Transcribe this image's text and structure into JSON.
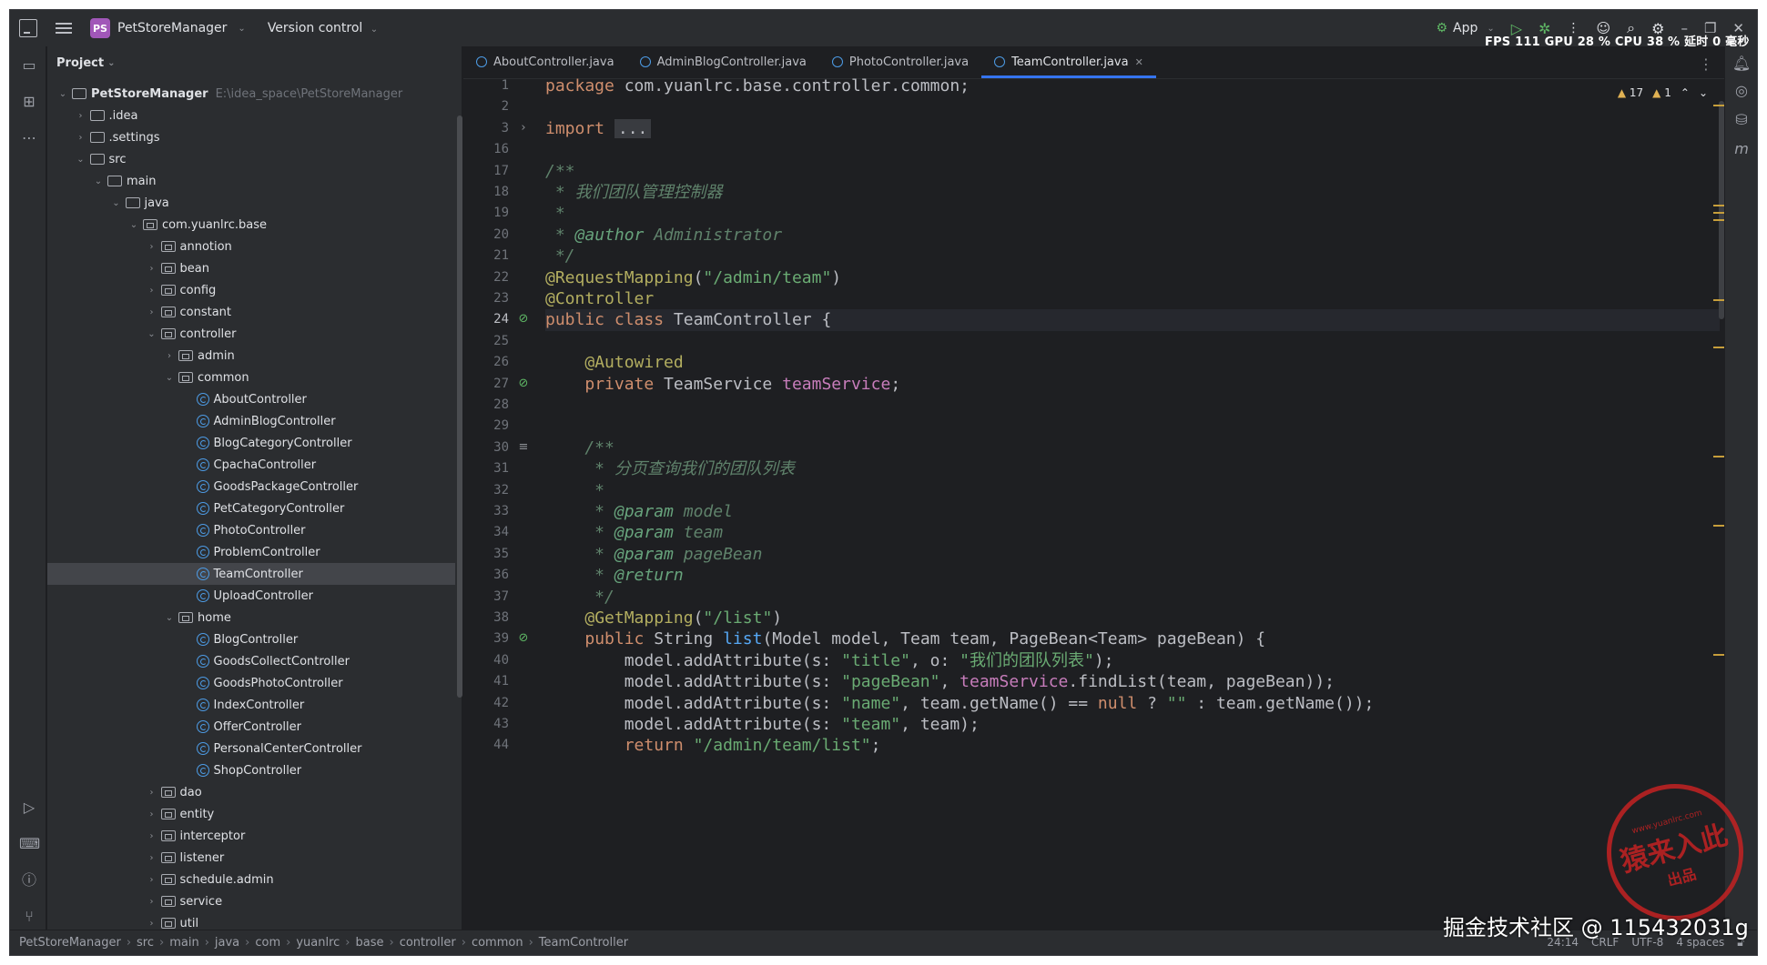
{
  "titlebar": {
    "project_badge": "PS",
    "project_name": "PetStoreManager",
    "version_control": "Version control",
    "run_config": "App",
    "fps": "FPS",
    "fps_value": "111",
    "gpu": "GPU",
    "gpu_value": "28 %",
    "cpu": "CPU",
    "cpu_value": "38 %",
    "latency": "延时",
    "latency_value": "0 毫秒"
  },
  "project_panel": {
    "title": "Project",
    "root": "PetStoreManager",
    "root_path": "E:\\idea_space\\PetStoreManager",
    "items": [
      {
        "label": "PetStoreManager",
        "depth": 0,
        "kind": "root",
        "open": true
      },
      {
        "label": ".idea",
        "depth": 1,
        "kind": "folder",
        "open": false
      },
      {
        "label": ".settings",
        "depth": 1,
        "kind": "folder",
        "open": false
      },
      {
        "label": "src",
        "depth": 1,
        "kind": "folder",
        "open": true
      },
      {
        "label": "main",
        "depth": 2,
        "kind": "folder",
        "open": true
      },
      {
        "label": "java",
        "depth": 3,
        "kind": "folder",
        "open": true
      },
      {
        "label": "com.yuanlrc.base",
        "depth": 4,
        "kind": "pkg",
        "open": true
      },
      {
        "label": "annotion",
        "depth": 5,
        "kind": "pkg",
        "open": false
      },
      {
        "label": "bean",
        "depth": 5,
        "kind": "pkg",
        "open": false
      },
      {
        "label": "config",
        "depth": 5,
        "kind": "pkg",
        "open": false
      },
      {
        "label": "constant",
        "depth": 5,
        "kind": "pkg",
        "open": false
      },
      {
        "label": "controller",
        "depth": 5,
        "kind": "pkg",
        "open": true
      },
      {
        "label": "admin",
        "depth": 6,
        "kind": "pkg",
        "open": false
      },
      {
        "label": "common",
        "depth": 6,
        "kind": "pkg",
        "open": true
      },
      {
        "label": "AboutController",
        "depth": 7,
        "kind": "class"
      },
      {
        "label": "AdminBlogController",
        "depth": 7,
        "kind": "class"
      },
      {
        "label": "BlogCategoryController",
        "depth": 7,
        "kind": "class"
      },
      {
        "label": "CpachaController",
        "depth": 7,
        "kind": "class"
      },
      {
        "label": "GoodsPackageController",
        "depth": 7,
        "kind": "class"
      },
      {
        "label": "PetCategoryController",
        "depth": 7,
        "kind": "class"
      },
      {
        "label": "PhotoController",
        "depth": 7,
        "kind": "class"
      },
      {
        "label": "ProblemController",
        "depth": 7,
        "kind": "class"
      },
      {
        "label": "TeamController",
        "depth": 7,
        "kind": "class",
        "selected": true
      },
      {
        "label": "UploadController",
        "depth": 7,
        "kind": "class"
      },
      {
        "label": "home",
        "depth": 6,
        "kind": "pkg",
        "open": true
      },
      {
        "label": "BlogController",
        "depth": 7,
        "kind": "class"
      },
      {
        "label": "GoodsCollectController",
        "depth": 7,
        "kind": "class"
      },
      {
        "label": "GoodsPhotoController",
        "depth": 7,
        "kind": "class"
      },
      {
        "label": "IndexController",
        "depth": 7,
        "kind": "class"
      },
      {
        "label": "OfferController",
        "depth": 7,
        "kind": "class"
      },
      {
        "label": "PersonalCenterController",
        "depth": 7,
        "kind": "class"
      },
      {
        "label": "ShopController",
        "depth": 7,
        "kind": "class"
      },
      {
        "label": "dao",
        "depth": 5,
        "kind": "pkg",
        "open": false
      },
      {
        "label": "entity",
        "depth": 5,
        "kind": "pkg",
        "open": false
      },
      {
        "label": "interceptor",
        "depth": 5,
        "kind": "pkg",
        "open": false
      },
      {
        "label": "listener",
        "depth": 5,
        "kind": "pkg",
        "open": false
      },
      {
        "label": "schedule.admin",
        "depth": 5,
        "kind": "pkg",
        "open": false
      },
      {
        "label": "service",
        "depth": 5,
        "kind": "pkg",
        "open": false
      },
      {
        "label": "util",
        "depth": 5,
        "kind": "pkg",
        "open": false
      }
    ]
  },
  "tabs": [
    {
      "label": "AboutController.java",
      "active": false
    },
    {
      "label": "AdminBlogController.java",
      "active": false
    },
    {
      "label": "PhotoController.java",
      "active": false
    },
    {
      "label": "TeamController.java",
      "active": true
    }
  ],
  "inspection": {
    "warnings": "17",
    "weak_warnings": "1"
  },
  "editor": {
    "current_line": "24",
    "lines": [
      {
        "n": "1",
        "t": "package com.yuanlrc.base.controller.common;"
      },
      {
        "n": "2",
        "t": ""
      },
      {
        "n": "3",
        "t": "import ..."
      },
      {
        "n": "16",
        "t": ""
      },
      {
        "n": "17",
        "t": "/**"
      },
      {
        "n": "18",
        "t": " * 我们团队管理控制器"
      },
      {
        "n": "19",
        "t": " *"
      },
      {
        "n": "20",
        "t": " * @author Administrator"
      },
      {
        "n": "21",
        "t": " */"
      },
      {
        "n": "22",
        "t": "@RequestMapping(\"/admin/team\")"
      },
      {
        "n": "23",
        "t": "@Controller"
      },
      {
        "n": "24",
        "t": "public class TeamController {"
      },
      {
        "n": "25",
        "t": ""
      },
      {
        "n": "26",
        "t": "    @Autowired"
      },
      {
        "n": "27",
        "t": "    private TeamService teamService;"
      },
      {
        "n": "28",
        "t": ""
      },
      {
        "n": "29",
        "t": ""
      },
      {
        "n": "30",
        "t": "    /**"
      },
      {
        "n": "31",
        "t": "     * 分页查询我们的团队列表"
      },
      {
        "n": "32",
        "t": "     *"
      },
      {
        "n": "33",
        "t": "     * @param model"
      },
      {
        "n": "34",
        "t": "     * @param team"
      },
      {
        "n": "35",
        "t": "     * @param pageBean"
      },
      {
        "n": "36",
        "t": "     * @return"
      },
      {
        "n": "37",
        "t": "     */"
      },
      {
        "n": "38",
        "t": "    @GetMapping(\"/list\")"
      },
      {
        "n": "39",
        "t": "    public String list(Model model, Team team, PageBean<Team> pageBean) {"
      },
      {
        "n": "40",
        "t": "        model.addAttribute(s: \"title\", o: \"我们的团队列表\");"
      },
      {
        "n": "41",
        "t": "        model.addAttribute(s: \"pageBean\", teamService.findList(team, pageBean));"
      },
      {
        "n": "42",
        "t": "        model.addAttribute(s: \"name\", team.getName() == null ? \"\" : team.getName());"
      },
      {
        "n": "43",
        "t": "        model.addAttribute(s: \"team\", team);"
      },
      {
        "n": "44",
        "t": "        return \"/admin/team/list\";"
      }
    ]
  },
  "statusbar": {
    "breadcrumbs": [
      "PetStoreManager",
      "src",
      "main",
      "java",
      "com",
      "yuanlrc",
      "base",
      "controller",
      "common",
      "TeamController"
    ],
    "position": "24:14",
    "line_sep": "CRLF",
    "encoding": "UTF-8",
    "indent": "4 spaces"
  },
  "watermark": {
    "text": "掘金技术社区 @ 115432031g",
    "stamp_url": "www.yuanlrc.com",
    "stamp_main": "猿来入此",
    "stamp_sub": "出品"
  }
}
